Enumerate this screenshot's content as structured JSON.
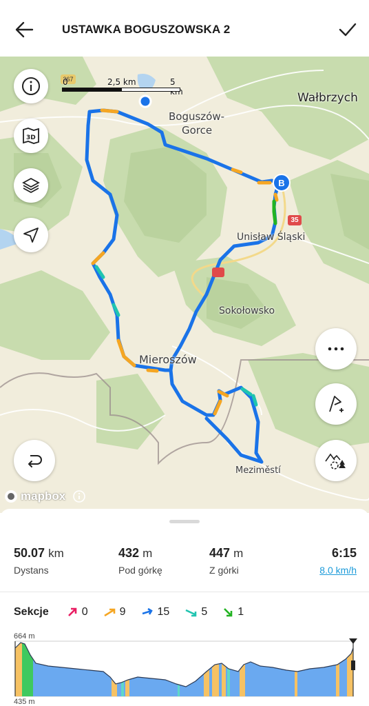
{
  "header": {
    "title": "USTAWKA BOGUSZOWSKA 2",
    "back_icon": "arrow-left-icon",
    "confirm_icon": "checkmark-icon"
  },
  "map": {
    "scale": {
      "zero": "0",
      "mid": "2,5 km",
      "end": "5 km"
    },
    "places": {
      "walbrzych": "Wałbrzych",
      "boguszow": "Boguszów-",
      "gorce": "Gorce",
      "unislaw": "Unisław Śląski",
      "sokolowsko": "Sokołowsko",
      "mieroszow": "Mieroszów",
      "mezimesti": "Meziměstí"
    },
    "road_badges": {
      "r35": "35",
      "r367": "367"
    },
    "end_marker": "B",
    "attribution": "mapbox",
    "colors": {
      "route_blue": "#1a73e8",
      "route_orange": "#f5a623",
      "route_green": "#22b322",
      "route_teal": "#20c4b0",
      "forest": "#c9ddb0",
      "land": "#f1eddc"
    }
  },
  "stats": {
    "distance": {
      "value": "50.07",
      "unit": "km",
      "label": "Dystans"
    },
    "ascent": {
      "value": "432",
      "unit": "m",
      "label": "Pod górkę"
    },
    "descent": {
      "value": "447",
      "unit": "m",
      "label": "Z górki"
    },
    "time": {
      "value": "6:15",
      "speed": "8.0 km/h"
    }
  },
  "sections": {
    "title": "Sekcje",
    "items": [
      {
        "icon": "steep-up-arrow-icon",
        "color": "#e91e63",
        "count": "0"
      },
      {
        "icon": "up-arrow-icon",
        "color": "#f5a623",
        "count": "9"
      },
      {
        "icon": "flat-arrow-icon",
        "color": "#1a73e8",
        "count": "15"
      },
      {
        "icon": "down-arrow-icon",
        "color": "#20c4b0",
        "count": "5"
      },
      {
        "icon": "steep-down-arrow-icon",
        "color": "#22b322",
        "count": "1"
      }
    ]
  },
  "profile": {
    "max_label": "664 m",
    "min_label": "435 m"
  }
}
